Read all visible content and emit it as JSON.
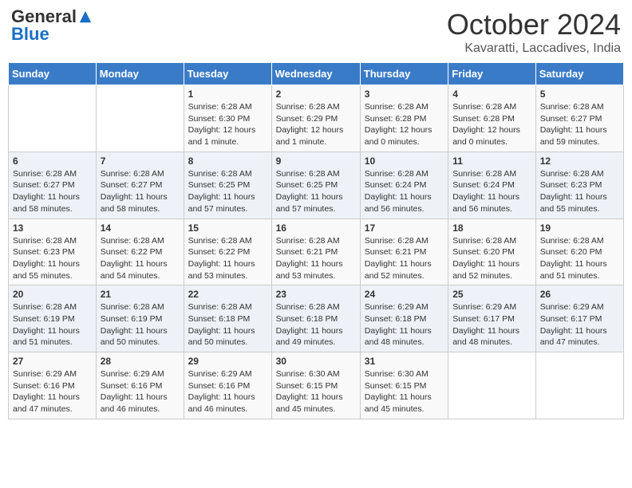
{
  "logo": {
    "general": "General",
    "blue": "Blue"
  },
  "header": {
    "title": "October 2024",
    "subtitle": "Kavaratti, Laccadives, India"
  },
  "weekdays": [
    "Sunday",
    "Monday",
    "Tuesday",
    "Wednesday",
    "Thursday",
    "Friday",
    "Saturday"
  ],
  "weeks": [
    [
      {
        "day": "",
        "info": ""
      },
      {
        "day": "",
        "info": ""
      },
      {
        "day": "1",
        "info": "Sunrise: 6:28 AM\nSunset: 6:30 PM\nDaylight: 12 hours and 1 minute."
      },
      {
        "day": "2",
        "info": "Sunrise: 6:28 AM\nSunset: 6:29 PM\nDaylight: 12 hours and 1 minute."
      },
      {
        "day": "3",
        "info": "Sunrise: 6:28 AM\nSunset: 6:28 PM\nDaylight: 12 hours and 0 minutes."
      },
      {
        "day": "4",
        "info": "Sunrise: 6:28 AM\nSunset: 6:28 PM\nDaylight: 12 hours and 0 minutes."
      },
      {
        "day": "5",
        "info": "Sunrise: 6:28 AM\nSunset: 6:27 PM\nDaylight: 11 hours and 59 minutes."
      }
    ],
    [
      {
        "day": "6",
        "info": "Sunrise: 6:28 AM\nSunset: 6:27 PM\nDaylight: 11 hours and 58 minutes."
      },
      {
        "day": "7",
        "info": "Sunrise: 6:28 AM\nSunset: 6:27 PM\nDaylight: 11 hours and 58 minutes."
      },
      {
        "day": "8",
        "info": "Sunrise: 6:28 AM\nSunset: 6:25 PM\nDaylight: 11 hours and 57 minutes."
      },
      {
        "day": "9",
        "info": "Sunrise: 6:28 AM\nSunset: 6:25 PM\nDaylight: 11 hours and 57 minutes."
      },
      {
        "day": "10",
        "info": "Sunrise: 6:28 AM\nSunset: 6:24 PM\nDaylight: 11 hours and 56 minutes."
      },
      {
        "day": "11",
        "info": "Sunrise: 6:28 AM\nSunset: 6:24 PM\nDaylight: 11 hours and 56 minutes."
      },
      {
        "day": "12",
        "info": "Sunrise: 6:28 AM\nSunset: 6:23 PM\nDaylight: 11 hours and 55 minutes."
      }
    ],
    [
      {
        "day": "13",
        "info": "Sunrise: 6:28 AM\nSunset: 6:23 PM\nDaylight: 11 hours and 55 minutes."
      },
      {
        "day": "14",
        "info": "Sunrise: 6:28 AM\nSunset: 6:22 PM\nDaylight: 11 hours and 54 minutes."
      },
      {
        "day": "15",
        "info": "Sunrise: 6:28 AM\nSunset: 6:22 PM\nDaylight: 11 hours and 53 minutes."
      },
      {
        "day": "16",
        "info": "Sunrise: 6:28 AM\nSunset: 6:21 PM\nDaylight: 11 hours and 53 minutes."
      },
      {
        "day": "17",
        "info": "Sunrise: 6:28 AM\nSunset: 6:21 PM\nDaylight: 11 hours and 52 minutes."
      },
      {
        "day": "18",
        "info": "Sunrise: 6:28 AM\nSunset: 6:20 PM\nDaylight: 11 hours and 52 minutes."
      },
      {
        "day": "19",
        "info": "Sunrise: 6:28 AM\nSunset: 6:20 PM\nDaylight: 11 hours and 51 minutes."
      }
    ],
    [
      {
        "day": "20",
        "info": "Sunrise: 6:28 AM\nSunset: 6:19 PM\nDaylight: 11 hours and 51 minutes."
      },
      {
        "day": "21",
        "info": "Sunrise: 6:28 AM\nSunset: 6:19 PM\nDaylight: 11 hours and 50 minutes."
      },
      {
        "day": "22",
        "info": "Sunrise: 6:28 AM\nSunset: 6:18 PM\nDaylight: 11 hours and 50 minutes."
      },
      {
        "day": "23",
        "info": "Sunrise: 6:28 AM\nSunset: 6:18 PM\nDaylight: 11 hours and 49 minutes."
      },
      {
        "day": "24",
        "info": "Sunrise: 6:29 AM\nSunset: 6:18 PM\nDaylight: 11 hours and 48 minutes."
      },
      {
        "day": "25",
        "info": "Sunrise: 6:29 AM\nSunset: 6:17 PM\nDaylight: 11 hours and 48 minutes."
      },
      {
        "day": "26",
        "info": "Sunrise: 6:29 AM\nSunset: 6:17 PM\nDaylight: 11 hours and 47 minutes."
      }
    ],
    [
      {
        "day": "27",
        "info": "Sunrise: 6:29 AM\nSunset: 6:16 PM\nDaylight: 11 hours and 47 minutes."
      },
      {
        "day": "28",
        "info": "Sunrise: 6:29 AM\nSunset: 6:16 PM\nDaylight: 11 hours and 46 minutes."
      },
      {
        "day": "29",
        "info": "Sunrise: 6:29 AM\nSunset: 6:16 PM\nDaylight: 11 hours and 46 minutes."
      },
      {
        "day": "30",
        "info": "Sunrise: 6:30 AM\nSunset: 6:15 PM\nDaylight: 11 hours and 45 minutes."
      },
      {
        "day": "31",
        "info": "Sunrise: 6:30 AM\nSunset: 6:15 PM\nDaylight: 11 hours and 45 minutes."
      },
      {
        "day": "",
        "info": ""
      },
      {
        "day": "",
        "info": ""
      }
    ]
  ]
}
